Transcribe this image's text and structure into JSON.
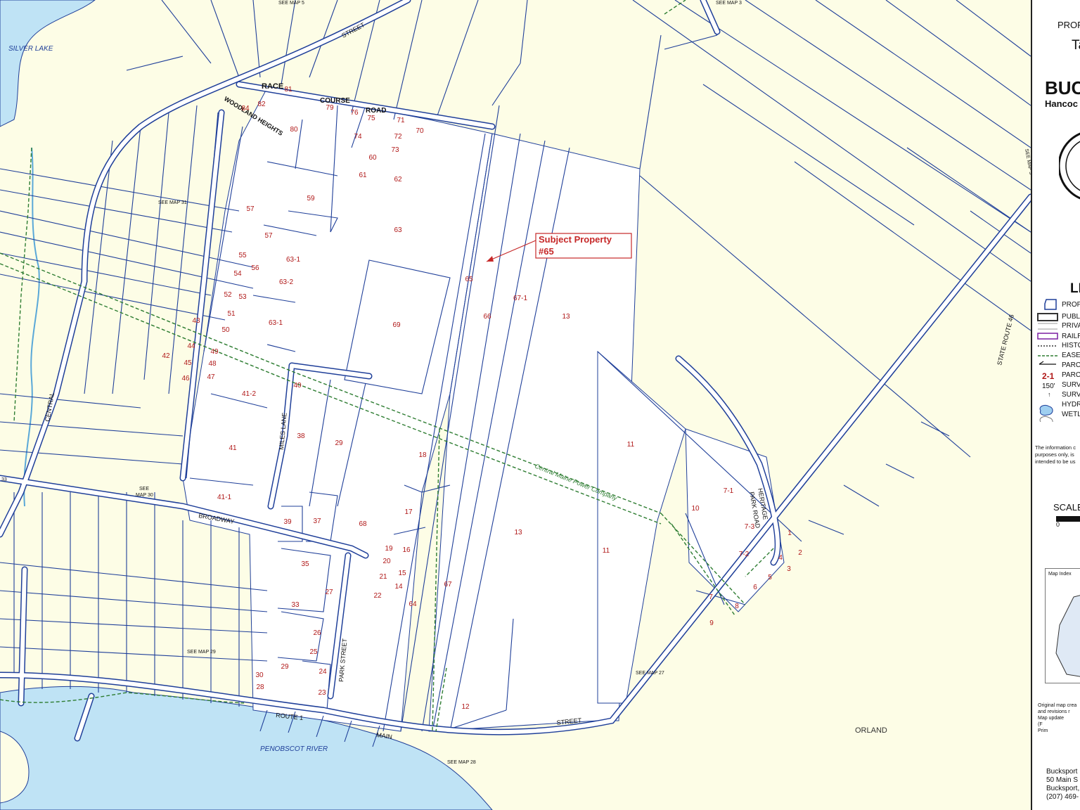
{
  "colors": {
    "background": "#fdfde6",
    "water": "#bfe3f5",
    "parcel_line": "#1f3f99",
    "parcel_fill": "#ffffff",
    "label_red": "#b01818",
    "easement": "#2e7d32",
    "callout": "#c62828"
  },
  "water_labels": {
    "silver_lake": "SILVER LAKE",
    "penobscot": "PENOBSCOT RIVER"
  },
  "place_labels": {
    "orland": "ORLAND"
  },
  "streets": {
    "street_top": "STREET",
    "race": "RACE",
    "course": "COURSE",
    "road": "ROAD",
    "woodland_heights": "WOODLAND HEIGHTS",
    "central": "CENTRAL",
    "miles_lane": "MILES LANE",
    "broadway": "BROADWAY",
    "park_street": "PARK STREET",
    "route1": "ROUTE 1",
    "main": "MAIN",
    "main_street": "STREET",
    "heritage": "HERITAGE",
    "park_road": "PARK ROAD",
    "state_route": "STATE ROUTE 46",
    "cmp": "Central Maine Power Company"
  },
  "map_refs": {
    "map5": "SEE MAP 5",
    "map3_top": "SEE MAP 3",
    "map3_side": "SEE MAP 3",
    "map31": "SEE MAP 31",
    "see30": "SEE",
    "map30": "MAP 30",
    "map29": "SEE MAP 29",
    "map27": "SEE MAP 27",
    "map28": "SEE MAP 28",
    "m33": "33"
  },
  "callout": {
    "line1": "Subject Property",
    "line2": "#65"
  },
  "parcel_labels": [
    {
      "t": "81"
    },
    {
      "t": "84"
    },
    {
      "t": "82"
    },
    {
      "t": "80"
    },
    {
      "t": "79"
    },
    {
      "t": "76"
    },
    {
      "t": "75"
    },
    {
      "t": "71"
    },
    {
      "t": "70"
    },
    {
      "t": "74"
    },
    {
      "t": "72"
    },
    {
      "t": "73"
    },
    {
      "t": "60"
    },
    {
      "t": "61"
    },
    {
      "t": "62"
    },
    {
      "t": "59"
    },
    {
      "t": "57"
    },
    {
      "t": "57"
    },
    {
      "t": "63"
    },
    {
      "t": "55"
    },
    {
      "t": "56"
    },
    {
      "t": "63-1"
    },
    {
      "t": "63-2"
    },
    {
      "t": "54"
    },
    {
      "t": "52"
    },
    {
      "t": "53"
    },
    {
      "t": "51"
    },
    {
      "t": "50"
    },
    {
      "t": "63-1"
    },
    {
      "t": "43"
    },
    {
      "t": "42"
    },
    {
      "t": "44"
    },
    {
      "t": "45"
    },
    {
      "t": "46"
    },
    {
      "t": "49"
    },
    {
      "t": "48"
    },
    {
      "t": "47"
    },
    {
      "t": "41-2"
    },
    {
      "t": "40"
    },
    {
      "t": "41"
    },
    {
      "t": "38"
    },
    {
      "t": "29"
    },
    {
      "t": "69"
    },
    {
      "t": "65"
    },
    {
      "t": "66"
    },
    {
      "t": "67-1"
    },
    {
      "t": "13"
    },
    {
      "t": "11"
    },
    {
      "t": "18"
    },
    {
      "t": "17"
    },
    {
      "t": "41-1"
    },
    {
      "t": "39"
    },
    {
      "t": "37"
    },
    {
      "t": "68"
    },
    {
      "t": "13"
    },
    {
      "t": "11"
    },
    {
      "t": "10"
    },
    {
      "t": "7-1"
    },
    {
      "t": "7-3"
    },
    {
      "t": "7-2"
    },
    {
      "t": "1"
    },
    {
      "t": "2"
    },
    {
      "t": "4"
    },
    {
      "t": "5"
    },
    {
      "t": "3"
    },
    {
      "t": "6"
    },
    {
      "t": "7"
    },
    {
      "t": "8"
    },
    {
      "t": "9"
    },
    {
      "t": "19"
    },
    {
      "t": "16"
    },
    {
      "t": "20"
    },
    {
      "t": "21"
    },
    {
      "t": "15"
    },
    {
      "t": "14"
    },
    {
      "t": "22"
    },
    {
      "t": "64"
    },
    {
      "t": "67"
    },
    {
      "t": "35"
    },
    {
      "t": "33"
    },
    {
      "t": "27"
    },
    {
      "t": "26"
    },
    {
      "t": "25"
    },
    {
      "t": "24"
    },
    {
      "t": "23"
    },
    {
      "t": "29"
    },
    {
      "t": "30"
    },
    {
      "t": "28"
    },
    {
      "t": "12"
    }
  ],
  "sidebar": {
    "title_prop": "PROP",
    "title_ta": "Ta",
    "town": "BUC",
    "county": "Hancoc",
    "legend_title": "LE",
    "legend": [
      {
        "label": "PROP"
      },
      {
        "label": "PUBLI"
      },
      {
        "label": "PRIVA"
      },
      {
        "label": "RAILR"
      },
      {
        "label": "HISTO"
      },
      {
        "label": "EASE"
      },
      {
        "label": "PARC"
      },
      {
        "label": "PARC"
      },
      {
        "label": "SURV"
      },
      {
        "label": "SURV"
      },
      {
        "label": "HYDR"
      },
      {
        "label": "WETL"
      }
    ],
    "legend_2_1": "2-1",
    "legend_150": "150'",
    "legend_arrow": "↑",
    "disclaimer": [
      "The information c",
      "purposes only, is",
      "intended to be us"
    ],
    "scale": "SCALE",
    "scale_zero": "0",
    "map_index": "Map Index",
    "credits": [
      "Original map crea",
      "and revisions r",
      "Map update",
      "(F",
      "Prim"
    ],
    "address": [
      "Bucksport",
      "50 Main S",
      "Bucksport,",
      "(207) 469-"
    ]
  }
}
